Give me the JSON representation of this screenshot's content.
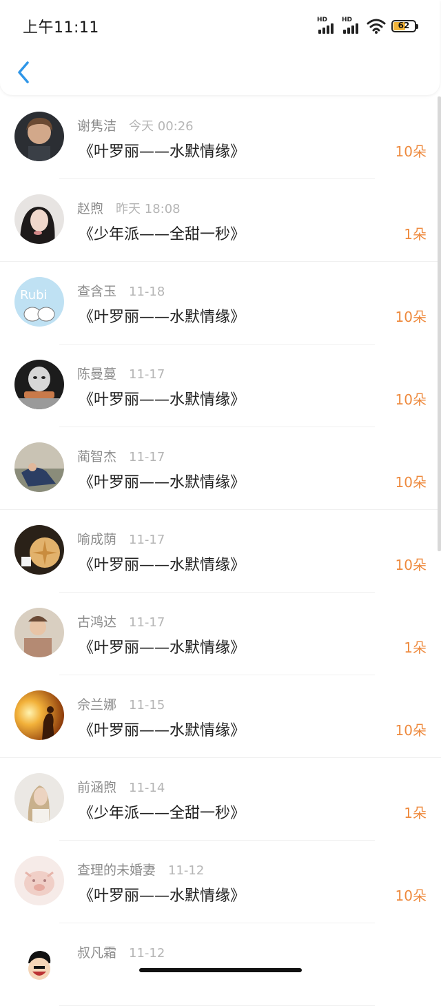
{
  "status_bar": {
    "time": "上午11:11",
    "battery_level": "62",
    "battery_percent": 62,
    "signal_label_1": "HD",
    "signal_label_2": "HD"
  },
  "colors": {
    "accent": "#2f96e8",
    "count_color": "#ee8a3e",
    "battery_fill": "#f1b43a"
  },
  "header": {
    "back_icon": "chevron-left-icon"
  },
  "items": [
    {
      "name": "谢隽洁",
      "time": "今天 00:26",
      "title": "《叶罗丽——水默情缘》",
      "count": "10朵"
    },
    {
      "name": "赵煦",
      "time": "昨天 18:08",
      "title": "《少年派——全甜一秒》",
      "count": "1朵"
    },
    {
      "name": "查含玉",
      "time": "11-18",
      "title": "《叶罗丽——水默情缘》",
      "count": "10朵"
    },
    {
      "name": "陈曼蔓",
      "time": "11-17",
      "title": "《叶罗丽——水默情缘》",
      "count": "10朵"
    },
    {
      "name": "蔺智杰",
      "time": "11-17",
      "title": "《叶罗丽——水默情缘》",
      "count": "10朵"
    },
    {
      "name": "喻成荫",
      "time": "11-17",
      "title": "《叶罗丽——水默情缘》",
      "count": "10朵"
    },
    {
      "name": "古鸿达",
      "time": "11-17",
      "title": "《叶罗丽——水默情缘》",
      "count": "1朵"
    },
    {
      "name": "佘兰娜",
      "time": "11-15",
      "title": "《叶罗丽——水默情缘》",
      "count": "10朵"
    },
    {
      "name": "前涵煦",
      "time": "11-14",
      "title": "《少年派——全甜一秒》",
      "count": "1朵"
    },
    {
      "name": "查理的未婚妻",
      "time": "11-12",
      "title": "《叶罗丽——水默情缘》",
      "count": "10朵"
    },
    {
      "name": "叔凡霜",
      "time": "11-12",
      "title": "",
      "count": ""
    }
  ]
}
